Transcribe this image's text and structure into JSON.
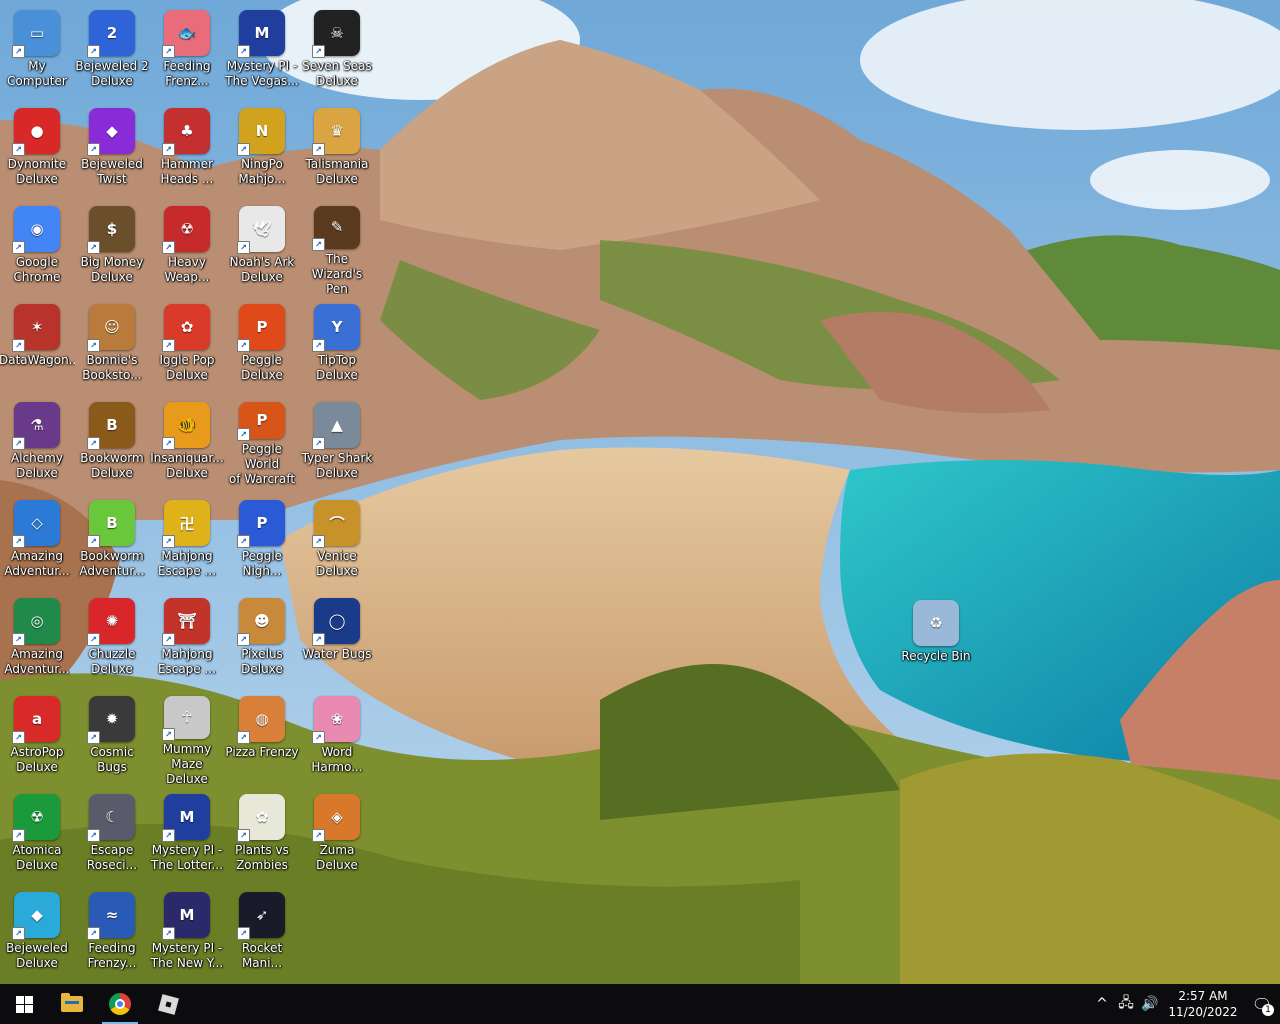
{
  "desktop": {
    "icons": [
      {
        "label": "My\nComputer",
        "color": "#4a90d9",
        "symbol": "▭",
        "icon": "my-computer-icon"
      },
      {
        "label": "Bejeweled 2\nDeluxe",
        "color": "#2f64d8",
        "symbol": "2",
        "icon": "bejeweled-2-icon"
      },
      {
        "label": "Feeding\nFrenz...",
        "color": "#e86c7a",
        "symbol": "🐟",
        "icon": "feeding-frenzy-icon"
      },
      {
        "label": "Mystery PI -\nThe Vegas...",
        "color": "#1f3e9e",
        "symbol": "M",
        "icon": "mystery-pi-vegas-icon"
      },
      {
        "label": "Seven Seas\nDeluxe",
        "color": "#222222",
        "symbol": "☠",
        "icon": "seven-seas-icon"
      },
      {
        "label": "Dynomite\nDeluxe",
        "color": "#d92828",
        "symbol": "●",
        "icon": "dynomite-icon"
      },
      {
        "label": "Bejeweled\nTwist",
        "color": "#8a2bd8",
        "symbol": "◆",
        "icon": "bejeweled-twist-icon"
      },
      {
        "label": "Hammer\nHeads ...",
        "color": "#c43030",
        "symbol": "♣",
        "icon": "hammer-heads-icon"
      },
      {
        "label": "NingPo\nMahjo...",
        "color": "#d1a21e",
        "symbol": "N",
        "icon": "ningpo-mahjong-icon"
      },
      {
        "label": "Talismania\nDeluxe",
        "color": "#d9a441",
        "symbol": "♛",
        "icon": "talismania-icon"
      },
      {
        "label": "Google\nChrome",
        "color": "#4285f4",
        "symbol": "◉",
        "icon": "chrome-icon"
      },
      {
        "label": "Big Money\nDeluxe",
        "color": "#6b4f2a",
        "symbol": "$",
        "icon": "big-money-icon"
      },
      {
        "label": "Heavy\nWeap...",
        "color": "#c62a2a",
        "symbol": "☢",
        "icon": "heavy-weapon-icon"
      },
      {
        "label": "Noah's Ark\nDeluxe",
        "color": "#e8e8e8",
        "symbol": "🕊",
        "icon": "noahs-ark-icon"
      },
      {
        "label": "The Wizard's\nPen",
        "color": "#5a3a1f",
        "symbol": "✎",
        "icon": "wizards-pen-icon"
      },
      {
        "label": "DataWagon...",
        "color": "#b8342a",
        "symbol": "✶",
        "icon": "datawagon-icon"
      },
      {
        "label": "Bonnie's\nBooksto...",
        "color": "#b87b3c",
        "symbol": "☺",
        "icon": "bonnies-bookstore-icon"
      },
      {
        "label": "Iggle Pop\nDeluxe",
        "color": "#d93a2a",
        "symbol": "✿",
        "icon": "iggle-pop-icon"
      },
      {
        "label": "Peggle\nDeluxe",
        "color": "#e04a1a",
        "symbol": "P",
        "icon": "peggle-icon"
      },
      {
        "label": "TipTop\nDeluxe",
        "color": "#3a6fd6",
        "symbol": "Y",
        "icon": "tiptop-icon"
      },
      {
        "label": "Alchemy\nDeluxe",
        "color": "#6a3a8a",
        "symbol": "⚗",
        "icon": "alchemy-icon"
      },
      {
        "label": "Bookworm\nDeluxe",
        "color": "#8a5a1a",
        "symbol": "B",
        "icon": "bookworm-icon"
      },
      {
        "label": "Insaniquar...\nDeluxe",
        "color": "#e89a1a",
        "symbol": "🐠",
        "icon": "insaniquarium-icon"
      },
      {
        "label": "Peggle World\nof Warcraft ...",
        "color": "#d8551a",
        "symbol": "P",
        "icon": "peggle-wow-icon"
      },
      {
        "label": "Typer Shark\nDeluxe",
        "color": "#7a8a9a",
        "symbol": "▲",
        "icon": "typer-shark-icon"
      },
      {
        "label": "Amazing\nAdventur...",
        "color": "#2a7ad6",
        "symbol": "◇",
        "icon": "amazing-adventures-icon"
      },
      {
        "label": "Bookworm\nAdventur...",
        "color": "#6ac63a",
        "symbol": "B",
        "icon": "bookworm-adventures-icon"
      },
      {
        "label": "Mahjong\nEscape ...",
        "color": "#e0b21a",
        "symbol": "卍",
        "icon": "mahjong-escape-icon"
      },
      {
        "label": "Peggle\nNigh...",
        "color": "#2a5ad6",
        "symbol": "P",
        "icon": "peggle-nights-icon"
      },
      {
        "label": "Venice\nDeluxe",
        "color": "#c8922a",
        "symbol": "⌒",
        "icon": "venice-icon"
      },
      {
        "label": "Amazing\nAdventur...",
        "color": "#1f8a4a",
        "symbol": "◎",
        "icon": "amazing-adventures-2-icon"
      },
      {
        "label": "Chuzzle\nDeluxe",
        "color": "#d9262a",
        "symbol": "✺",
        "icon": "chuzzle-icon"
      },
      {
        "label": "Mahjong\nEscape ...",
        "color": "#c2342a",
        "symbol": "⛩",
        "icon": "mahjong-escape-2-icon"
      },
      {
        "label": "Pixelus\nDeluxe",
        "color": "#c88a3a",
        "symbol": "☻",
        "icon": "pixelus-icon"
      },
      {
        "label": "Water Bugs",
        "color": "#1a3a8a",
        "symbol": "◯",
        "icon": "water-bugs-icon"
      },
      {
        "label": "AstroPop\nDeluxe",
        "color": "#d92a2a",
        "symbol": "a",
        "icon": "astropop-icon"
      },
      {
        "label": "Cosmic Bugs",
        "color": "#3a3a3a",
        "symbol": "✹",
        "icon": "cosmic-bugs-icon"
      },
      {
        "label": "Mummy\nMaze Deluxe",
        "color": "#c8c8c8",
        "symbol": "☥",
        "icon": "mummy-maze-icon"
      },
      {
        "label": "Pizza Frenzy",
        "color": "#d8803a",
        "symbol": "◍",
        "icon": "pizza-frenzy-icon"
      },
      {
        "label": "Word\nHarmo...",
        "color": "#e88ab2",
        "symbol": "❀",
        "icon": "word-harmony-icon"
      },
      {
        "label": "Atomica\nDeluxe",
        "color": "#1a9a3a",
        "symbol": "☢",
        "icon": "atomica-icon"
      },
      {
        "label": "Escape\nRoseci...",
        "color": "#5a5a6a",
        "symbol": "☾",
        "icon": "escape-rosecliff-icon"
      },
      {
        "label": "Mystery PI -\nThe Lotter...",
        "color": "#1f3e9e",
        "symbol": "M",
        "icon": "mystery-pi-lottery-icon"
      },
      {
        "label": "Plants vs\nZombies",
        "color": "#e8e8d8",
        "symbol": "✿",
        "icon": "plants-vs-zombies-icon"
      },
      {
        "label": "Zuma Deluxe",
        "color": "#d8782a",
        "symbol": "◈",
        "icon": "zuma-icon"
      },
      {
        "label": "Bejeweled\nDeluxe",
        "color": "#2aaad8",
        "symbol": "◆",
        "icon": "bejeweled-deluxe-icon"
      },
      {
        "label": "Feeding\nFrenzy...",
        "color": "#2a5ab8",
        "symbol": "≈",
        "icon": "feeding-frenzy-2-icon"
      },
      {
        "label": "Mystery PI -\nThe New Y...",
        "color": "#2a2a6a",
        "symbol": "M",
        "icon": "mystery-pi-newyork-icon"
      },
      {
        "label": "Rocket\nMani...",
        "color": "#1a1a2a",
        "symbol": "➶",
        "icon": "rocket-mania-icon"
      }
    ],
    "recycle_bin": {
      "label": "Recycle Bin",
      "color": "#9ab8d8",
      "symbol": "♻",
      "icon": "recycle-bin-icon"
    }
  },
  "taskbar": {
    "pinned": [
      "start",
      "file-explorer",
      "google-chrome",
      "roblox"
    ],
    "clock_time": "2:57 AM",
    "clock_date": "11/20/2022",
    "notification_count": "1",
    "tray_symbols": {
      "chevron": "^",
      "network": "🖧",
      "volume": "🔊",
      "notif": "🗨"
    }
  }
}
